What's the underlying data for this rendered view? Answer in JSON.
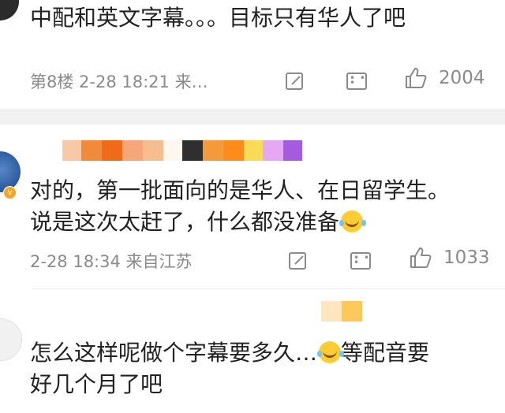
{
  "comments": [
    {
      "text": "中配和英文字幕。。。目标只有华人了吧",
      "meta": "第8楼 2-28 18:21 来…",
      "likes": "2004"
    },
    {
      "text_line1": "对的，第一批面向的是华人、在日留学生。",
      "text_line2": "说是这次太赶了，什么都没准备",
      "meta": "2-28 18:34 来自江苏",
      "likes": "1033"
    },
    {
      "text_line1": "怎么这样呢做个字幕要多久…",
      "text_line1_tail": "等配音要",
      "text_line2": "好几个月了吧"
    }
  ],
  "icons": {
    "share": "share-icon",
    "comment": "comment-icon",
    "like": "like-icon",
    "emoji": "laugh-cry-emoji"
  },
  "colors": {
    "censor_row": [
      "#f7c9a6",
      "#f28a3c",
      "#ef6b17",
      "#f5a779",
      "#f8bd8f",
      "#ffffff",
      "#2f2f2f",
      "#f39a3a",
      "#ff8c1a",
      "#f8dc57",
      "#e4a8f5",
      "#a55be0"
    ],
    "censor_row3": [
      "#ffe6bf",
      "#ffc85a"
    ]
  }
}
